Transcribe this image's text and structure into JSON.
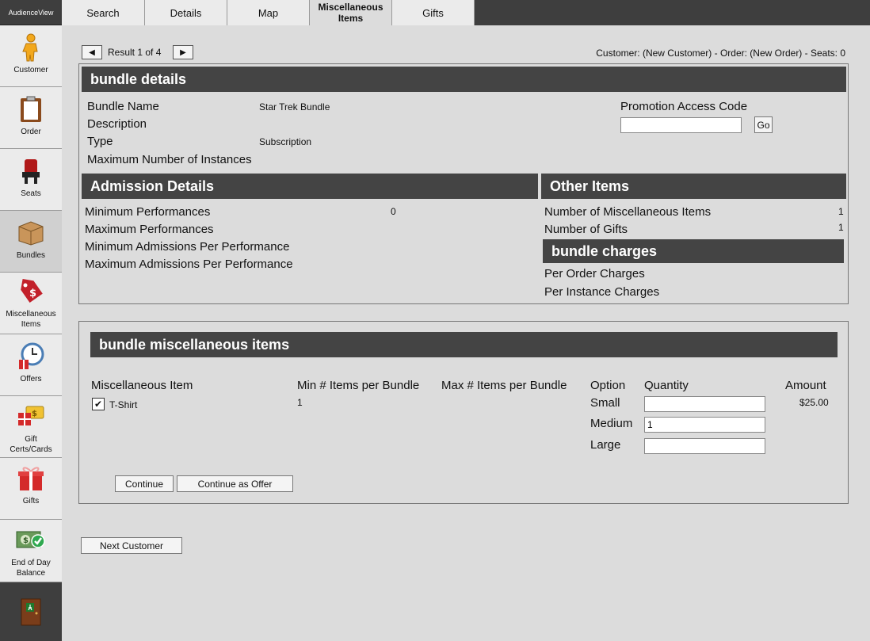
{
  "app": {
    "brand": "AudienceView"
  },
  "sidebar": {
    "items": [
      {
        "label": "Customer",
        "icon": "person-icon"
      },
      {
        "label": "Order",
        "icon": "clipboard-icon"
      },
      {
        "label": "Seats",
        "icon": "seat-icon"
      },
      {
        "label": "Bundles",
        "icon": "box-icon"
      },
      {
        "label": "Miscellaneous Items",
        "icon": "price-tag-icon"
      },
      {
        "label": "Offers",
        "icon": "clock-gift-icon"
      },
      {
        "label": "Gift Certs/Cards",
        "icon": "gift-card-icon"
      },
      {
        "label": "Gifts",
        "icon": "gift-icon"
      },
      {
        "label": "End of Day Balance",
        "icon": "money-check-icon"
      }
    ]
  },
  "tabs": [
    {
      "label": "Search"
    },
    {
      "label": "Details"
    },
    {
      "label": "Map"
    },
    {
      "label": "Miscellaneous Items"
    },
    {
      "label": "Gifts"
    }
  ],
  "pager": {
    "text": "Result 1 of 4"
  },
  "status": {
    "text": "Customer: (New Customer) - Order: (New Order) - Seats: 0"
  },
  "bundle_details": {
    "title": "bundle details",
    "name_label": "Bundle Name",
    "name_value": "Star Trek Bundle",
    "description_label": "Description",
    "type_label": "Type",
    "type_value": "Subscription",
    "max_instances_label": "Maximum Number of Instances",
    "promo_label": "Promotion Access Code",
    "promo_value": "",
    "go_label": "Go"
  },
  "admission": {
    "title": "Admission Details",
    "min_perf_label": "Minimum Performances",
    "min_perf_value": "0",
    "max_perf_label": "Maximum Performances",
    "min_adm_label": "Minimum Admissions Per Performance",
    "max_adm_label": "Maximum Admissions Per Performance"
  },
  "other_items": {
    "title": "Other Items",
    "misc_count_label": "Number of Miscellaneous Items",
    "misc_count_value": "1",
    "gifts_count_label": "Number of Gifts",
    "gifts_count_value": "1"
  },
  "charges": {
    "title": "bundle charges",
    "per_order_label": "Per Order Charges",
    "per_instance_label": "Per Instance Charges"
  },
  "misc_items": {
    "title": "bundle miscellaneous items",
    "col_item": "Miscellaneous Item",
    "col_min": "Min # Items per Bundle",
    "col_max": "Max # Items per Bundle",
    "col_option": "Option",
    "col_quantity": "Quantity",
    "col_amount": "Amount",
    "item_name": "T-Shirt",
    "item_checked": "✔",
    "item_min": "1",
    "amount": "$25.00",
    "options": [
      {
        "label": "Small",
        "quantity": ""
      },
      {
        "label": "Medium",
        "quantity": "1"
      },
      {
        "label": "Large",
        "quantity": ""
      }
    ],
    "continue_label": "Continue",
    "continue_offer_label": "Continue as Offer"
  },
  "footer": {
    "next_customer_label": "Next Customer"
  }
}
